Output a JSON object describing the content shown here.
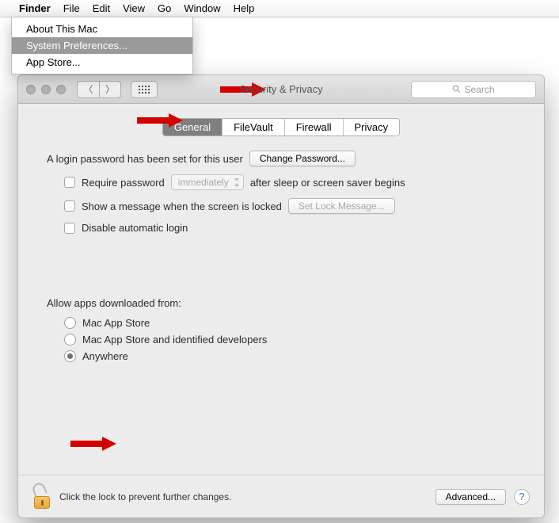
{
  "menubar": {
    "items": [
      "Finder",
      "File",
      "Edit",
      "View",
      "Go",
      "Window",
      "Help"
    ]
  },
  "apple_menu": {
    "items": [
      "About This Mac",
      "System Preferences...",
      "App Store..."
    ],
    "highlighted_index": 1
  },
  "window": {
    "title": "Security & Privacy",
    "search_placeholder": "Search"
  },
  "tabs": [
    "General",
    "FileVault",
    "Firewall",
    "Privacy"
  ],
  "active_tab_index": 0,
  "general": {
    "login_text": "A login password has been set for this user",
    "change_password_btn": "Change Password...",
    "require_password_label": "Require password",
    "require_delay": "immediately",
    "require_suffix": "after sleep or screen saver begins",
    "show_message_label": "Show a message when the screen is locked",
    "set_lock_msg_btn": "Set Lock Message...",
    "disable_auto_login": "Disable automatic login",
    "allow_heading": "Allow apps downloaded from:",
    "options": [
      "Mac App Store",
      "Mac App Store and identified developers",
      "Anywhere"
    ],
    "selected_option_index": 2
  },
  "footer": {
    "lock_text": "Click the lock to prevent further changes.",
    "advanced_btn": "Advanced...",
    "help": "?"
  }
}
